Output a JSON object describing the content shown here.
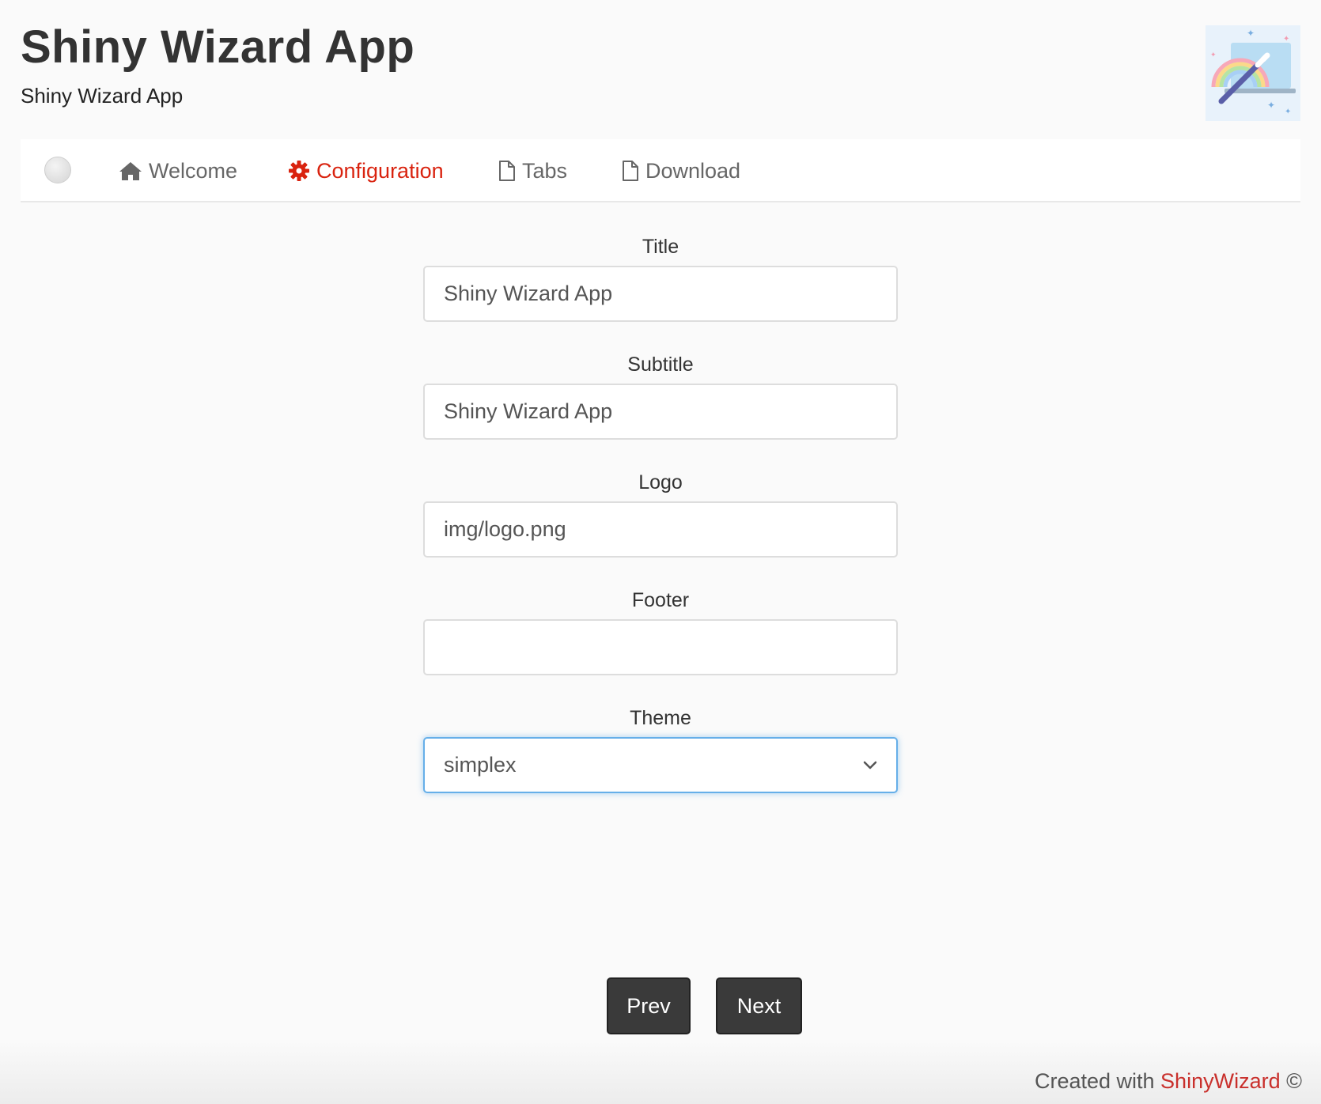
{
  "app": {
    "title": "Shiny Wizard App",
    "subtitle": "Shiny Wizard App"
  },
  "nav": {
    "items": [
      {
        "label": "Welcome",
        "icon": "home-icon"
      },
      {
        "label": "Configuration",
        "icon": "gear-icon",
        "active": true
      },
      {
        "label": "Tabs",
        "icon": "file-icon"
      },
      {
        "label": "Download",
        "icon": "file-icon"
      }
    ]
  },
  "form": {
    "title_label": "Title",
    "title_value": "Shiny Wizard App",
    "subtitle_label": "Subtitle",
    "subtitle_value": "Shiny Wizard App",
    "logo_label": "Logo",
    "logo_value": "img/logo.png",
    "footer_label": "Footer",
    "footer_value": "",
    "theme_label": "Theme",
    "theme_value": "simplex"
  },
  "buttons": {
    "prev": "Prev",
    "next": "Next"
  },
  "footer": {
    "prefix": "Created with ",
    "brand": "ShinyWizard",
    "suffix": " ©"
  },
  "colors": {
    "accent": "#d9230f",
    "button": "#3a3a3a",
    "focus_border": "#66afe9"
  }
}
